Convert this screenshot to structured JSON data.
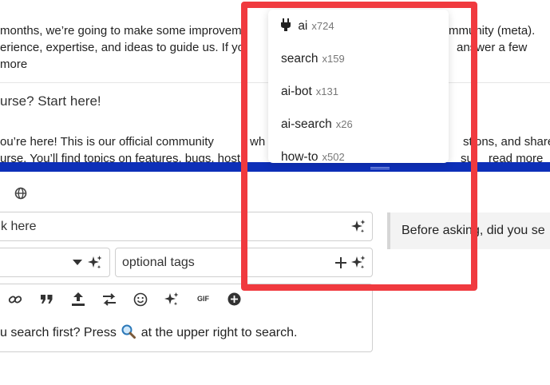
{
  "topics": {
    "line1": "months, we’re going to make some improvem",
    "line1b": "mmunity (meta).",
    "line2": "erience, expertise, and ideas to guide us. If yo",
    "line2b": "answer a few",
    "line3": "more",
    "title2": "urse? Start here!",
    "line4": "ou’re here! This is our official community",
    "line4b": "wh",
    "line4c": "stions, and share",
    "line5": "urse. You’ll find topics on features, bugs, host",
    "line5b": "sur",
    "read_more": "read more"
  },
  "composer": {
    "title_placeholder": "k here",
    "tags_placeholder": "optional tags",
    "preview_text": "Before asking, did you se",
    "editor_text_before": "u search first? Press",
    "editor_text_after": "at the upper right to search.",
    "toolbar_gif": "GIF"
  },
  "dropdown": {
    "items": [
      {
        "label": "ai",
        "count": "x724",
        "icon": "plug-icon"
      },
      {
        "label": "search",
        "count": "x159"
      },
      {
        "label": "ai-bot",
        "count": "x131"
      },
      {
        "label": "ai-search",
        "count": "x26"
      },
      {
        "label": "how-to",
        "count": "x502"
      }
    ]
  },
  "colors": {
    "highlight": "#f03a3f",
    "composer_bar": "#0d2fb8"
  }
}
